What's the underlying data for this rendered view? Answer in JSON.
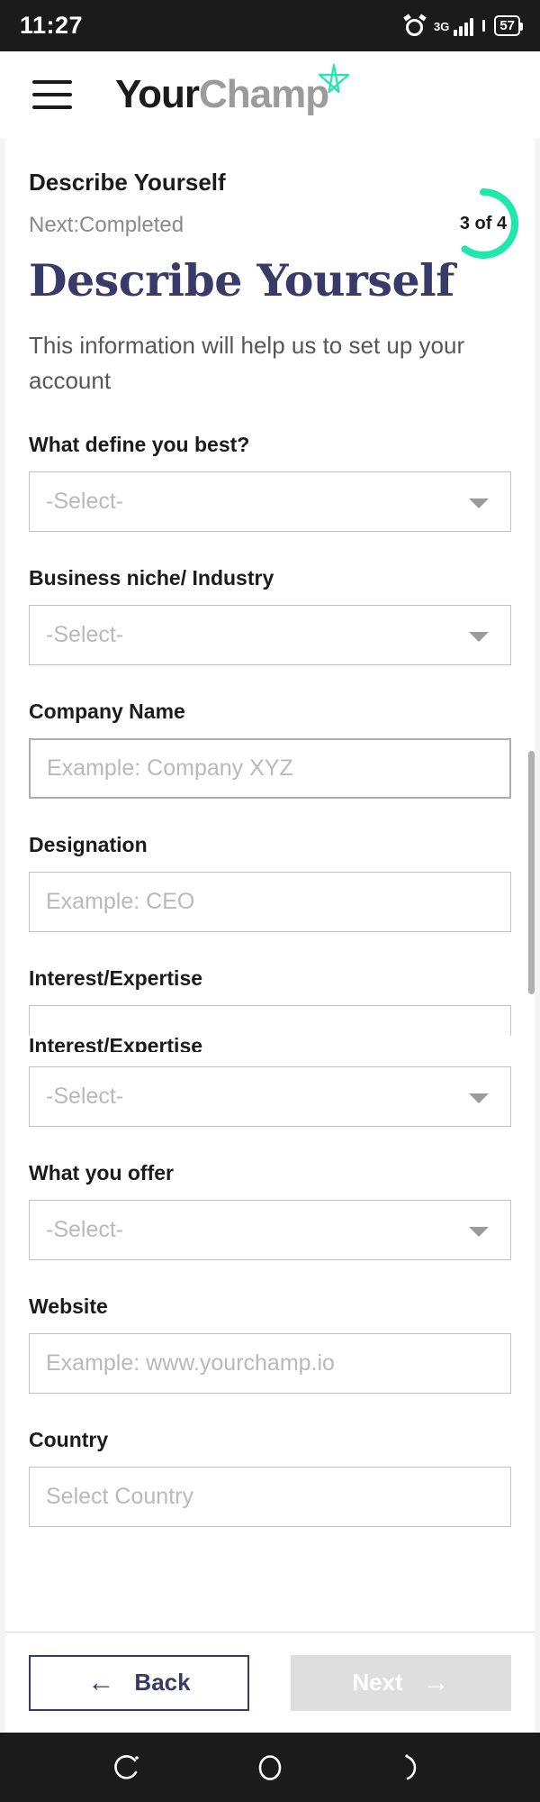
{
  "status_bar": {
    "time": "11:27",
    "alarm_icon": "alarm-clock-icon",
    "network_type": "3G",
    "signal_icon": "signal-bars-icon",
    "battery_percent": "57"
  },
  "app_bar": {
    "menu_icon": "hamburger-menu-icon",
    "logo_primary": "Your",
    "logo_secondary": "Champ",
    "logo_star_icon": "star-icon",
    "star_color": "#1EE8AB"
  },
  "header": {
    "step_title": "Describe Yourself",
    "next_step": "Next:Completed",
    "progress_label": "3 of 4",
    "progress_current": 3,
    "progress_total": 4,
    "progress_color": "#1EE8AB",
    "progress_track_color": "#ffffff",
    "page_title": "Describe Yourself",
    "page_title_color": "#383A68",
    "subtitle": "This information will help us to set up your account"
  },
  "form": {
    "fields": [
      {
        "label": "What define you best?",
        "type": "select",
        "value": "-Select-",
        "name": "what-defines-you-best"
      },
      {
        "label": "Business niche/ Industry",
        "type": "select",
        "value": "-Select-",
        "name": "business-niche-industry"
      },
      {
        "label": "Company Name",
        "type": "text",
        "placeholder": "Example: Company XYZ",
        "name": "company-name"
      },
      {
        "label": "Designation",
        "type": "text",
        "placeholder": "Example: CEO",
        "name": "designation"
      },
      {
        "label": "Interest/Expertise",
        "type": "select",
        "value": "-Select-",
        "name": "interest-expertise",
        "duplicate_label": "Interest/Expertise"
      },
      {
        "label": "What you offer",
        "type": "select",
        "value": "-Select-",
        "name": "what-you-offer"
      },
      {
        "label": "Website",
        "type": "text",
        "placeholder": "Example: www.yourchamp.io",
        "name": "website"
      },
      {
        "label": "Country",
        "type": "select",
        "value": "Select Country",
        "name": "country"
      }
    ]
  },
  "footer": {
    "back_label": "Back",
    "back_icon": "arrow-left-icon",
    "back_color": "#383A68",
    "next_label": "Next",
    "next_icon": "arrow-right-icon",
    "next_disabled": true,
    "next_bg_color": "#DEDEDE"
  },
  "nav_bar": {
    "recent_icon": "recent-apps-icon",
    "home_icon": "home-circle-icon",
    "back_icon": "back-icon"
  }
}
